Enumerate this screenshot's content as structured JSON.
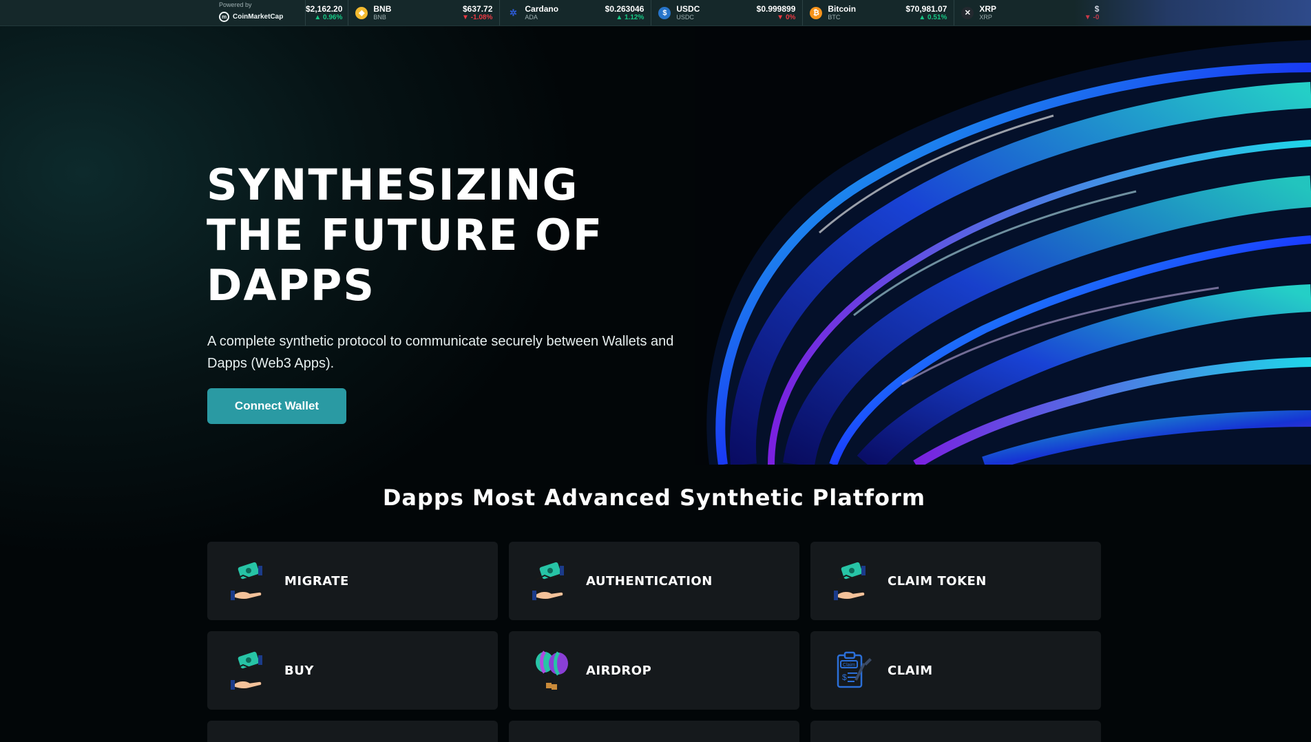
{
  "ticker": {
    "powered_label": "Powered by",
    "provider": "CoinMarketCap",
    "first": {
      "price": "$2,162.20",
      "change": "0.96%",
      "direction": "up"
    },
    "coins": [
      {
        "name": "BNB",
        "symbol": "BNB",
        "price": "$637.72",
        "change": "-1.08%",
        "direction": "down",
        "icon": "bnb-icon",
        "color": "#f3ba2f"
      },
      {
        "name": "Cardano",
        "symbol": "ADA",
        "price": "$0.263046",
        "change": "1.12%",
        "direction": "up",
        "icon": "cardano-icon",
        "color": "#0033ad"
      },
      {
        "name": "USDC",
        "symbol": "USDC",
        "price": "$0.999899",
        "change": "0%",
        "direction": "down",
        "icon": "usdc-icon",
        "color": "#2775ca"
      },
      {
        "name": "Bitcoin",
        "symbol": "BTC",
        "price": "$70,981.07",
        "change": "0.51%",
        "direction": "up",
        "icon": "bitcoin-icon",
        "color": "#f7931a"
      },
      {
        "name": "XRP",
        "symbol": "XRP",
        "price": "$",
        "change": "-0",
        "direction": "down",
        "icon": "xrp-icon",
        "color": "#23292f"
      }
    ]
  },
  "hero": {
    "title_lines": [
      "SYNTHESIZING",
      "THE FUTURE OF",
      "DAPPS"
    ],
    "description": "A complete synthetic protocol to communicate securely between Wallets and Dapps (Web3 Apps).",
    "cta": "Connect Wallet"
  },
  "features": {
    "title": "Dapps Most Advanced Synthetic Platform",
    "cards": [
      {
        "label": "MIGRATE",
        "icon": "hand-money-icon"
      },
      {
        "label": "AUTHENTICATION",
        "icon": "hand-money-icon"
      },
      {
        "label": "CLAIM TOKEN",
        "icon": "hand-money-icon"
      },
      {
        "label": "BUY",
        "icon": "hand-money-icon"
      },
      {
        "label": "AIRDROP",
        "icon": "balloon-icon"
      },
      {
        "label": "CLAIM",
        "icon": "claim-document-icon"
      }
    ]
  },
  "colors": {
    "accent": "#2a9aa3",
    "card_bg": "#15191c",
    "up": "#16c784",
    "down": "#ea3943"
  }
}
